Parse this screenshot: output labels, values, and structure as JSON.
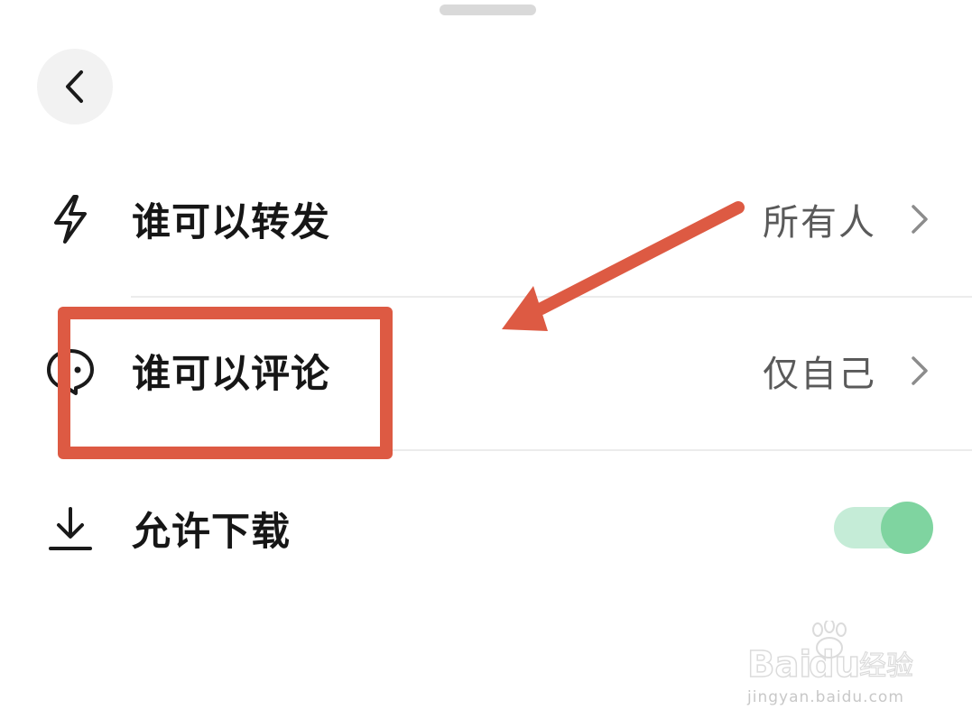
{
  "sheet": {
    "back_button_icon": "chevron-left-icon"
  },
  "settings": {
    "forward": {
      "icon": "lightning-icon",
      "label": "谁可以转发",
      "value": "所有人"
    },
    "comment": {
      "icon": "comment-icon",
      "label": "谁可以评论",
      "value": "仅自己"
    },
    "download": {
      "icon": "download-icon",
      "label": "允许下载",
      "enabled": true
    }
  },
  "annotation": {
    "color": "#dd5a43"
  },
  "watermark": {
    "brand": "Baidu经验",
    "url": "jingyan.baidu.com"
  },
  "colors": {
    "toggle_track": "#c5ecd7",
    "toggle_knob": "#7fd4a0",
    "text_primary": "#161616",
    "text_secondary": "#5a5a5a"
  }
}
